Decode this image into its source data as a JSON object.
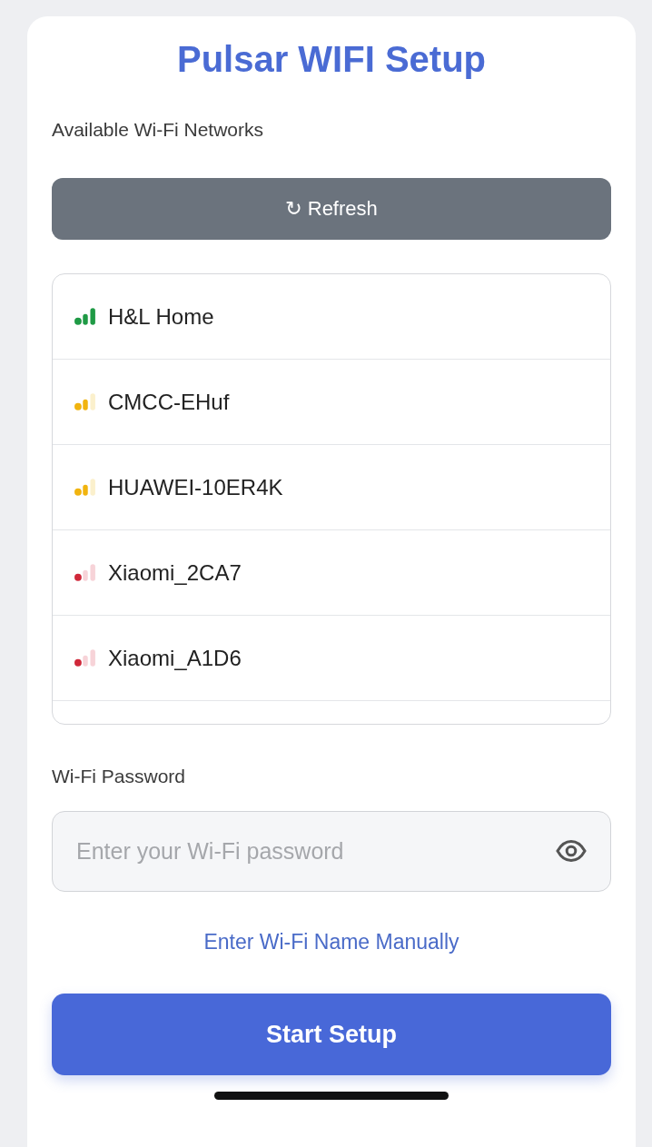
{
  "title": "Pulsar WIFI Setup",
  "networks_label": "Available Wi‑Fi Networks",
  "refresh_button": "↻ Refresh",
  "networks": [
    {
      "name": "H&L Home",
      "kind": "strong"
    },
    {
      "name": "CMCC‑EHuf",
      "kind": "medium"
    },
    {
      "name": "HUAWEI‑10ER4K",
      "kind": "medium"
    },
    {
      "name": "Xiaomi_2CA7",
      "kind": "weak"
    },
    {
      "name": "Xiaomi_A1D6",
      "kind": "weak"
    }
  ],
  "password": {
    "label": "Wi‑Fi Password",
    "placeholder": "Enter your Wi‑Fi password"
  },
  "manual_link": "Enter Wi‑Fi Name Manually",
  "start_button": "Start Setup"
}
